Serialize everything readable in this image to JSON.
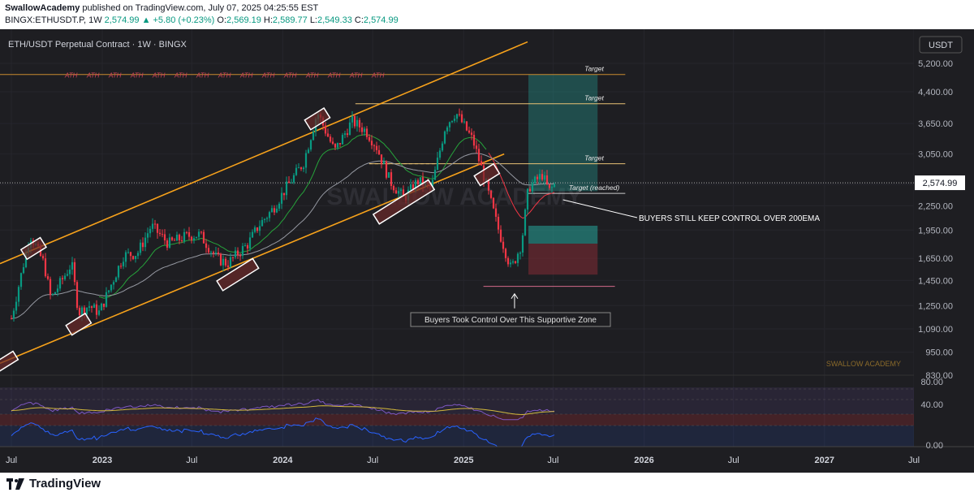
{
  "header": {
    "author": "SwallowAcademy",
    "published": "published on TradingView.com, July 07, 2025 04:25:55 EST",
    "symbol": "BINGX:ETHUSDT.P, 1W",
    "last": "2,574.99",
    "change": "▲ +5.80 (+0.23%)",
    "o_label": "O:",
    "o": "2,569.19",
    "h_label": "H:",
    "h": "2,589.77",
    "l_label": "L:",
    "l": "2,549.33",
    "c_label": "C:",
    "c": "2,574.99"
  },
  "pane": {
    "title": "ETH/USDT Perpetual Contract · 1W · BINGX",
    "currency": "USDT",
    "watermark": "SWALLOW ACADEMY",
    "watermark_small": "SWALLOW ACADEMY"
  },
  "annotations": {
    "ath": "ATH",
    "target": "Target",
    "target_reached": "Target (reached)",
    "buyers_200ema": "BUYERS STILL KEEP CONTROL OVER 200EMA",
    "buyers_zone": "Buyers Took Control Over This Supportive Zone"
  },
  "footer": {
    "brand": "TradingView"
  },
  "colors": {
    "bg": "#1e1e22",
    "up": "#089981",
    "down": "#f23645",
    "channel": "#f7a21b",
    "target_line": "#e8c274",
    "ema_short": "#26a33b",
    "ema_long": "#9598a1",
    "rsi": "#7e57c2",
    "rsi_ma": "#d4b93c",
    "osc": "#2962ff",
    "tp_zone": "#26a69a",
    "sl_zone": "#7a2a33",
    "ath_line": "#c88a2e",
    "ath_text": "#d0435a"
  },
  "chart_data": {
    "type": "candlestick",
    "title": "ETH/USDT Perpetual Contract · 1W · BINGX",
    "y_scale": "log",
    "ylim": [
      830,
      5200
    ],
    "y_ticks": [
      5200,
      4400,
      3650,
      3050,
      2550,
      2250,
      1950,
      1650,
      1450,
      1250,
      1090,
      950,
      830
    ],
    "y_tick_labels": [
      "5,200.00",
      "4,400.00",
      "3,650.00",
      "3,050.00",
      "2,550.00",
      "2,250.00",
      "1,950.00",
      "1,650.00",
      "1,450.00",
      "1,250.00",
      "1,090.00",
      "950.00",
      "830.00"
    ],
    "x_ticks": [
      "2022-07",
      "2023-01",
      "2023-07",
      "2024-01",
      "2024-07",
      "2025-01",
      "2025-07",
      "2026-01",
      "2026-07",
      "2027-01",
      "2027-07"
    ],
    "x_tick_labels": [
      "Jul",
      "2023",
      "Jul",
      "2024",
      "Jul",
      "2025",
      "Jul",
      "2026",
      "Jul",
      "2027",
      "Jul"
    ],
    "price_path": [
      [
        "2022-06-13",
        1000
      ],
      [
        "2022-06-27",
        1100
      ],
      [
        "2022-08-08",
        1900
      ],
      [
        "2022-09-05",
        1600
      ],
      [
        "2022-09-19",
        1300
      ],
      [
        "2022-10-31",
        1600
      ],
      [
        "2022-11-14",
        1200
      ],
      [
        "2022-12-05",
        1250
      ],
      [
        "2022-12-26",
        1200
      ],
      [
        "2023-02-13",
        1680
      ],
      [
        "2023-03-13",
        1700
      ],
      [
        "2023-04-10",
        2000
      ],
      [
        "2023-05-15",
        1800
      ],
      [
        "2023-06-19",
        1880
      ],
      [
        "2023-07-17",
        1900
      ],
      [
        "2023-08-21",
        1650
      ],
      [
        "2023-09-11",
        1600
      ],
      [
        "2023-10-23",
        1800
      ],
      [
        "2023-11-13",
        2000
      ],
      [
        "2023-12-11",
        2200
      ],
      [
        "2024-01-08",
        2500
      ],
      [
        "2024-02-12",
        2900
      ],
      [
        "2024-03-11",
        3900
      ],
      [
        "2024-04-15",
        3100
      ],
      [
        "2024-05-20",
        3700
      ],
      [
        "2024-06-17",
        3500
      ],
      [
        "2024-07-08",
        3200
      ],
      [
        "2024-08-05",
        2600
      ],
      [
        "2024-09-02",
        2350
      ],
      [
        "2024-09-30",
        2600
      ],
      [
        "2024-10-28",
        2500
      ],
      [
        "2024-11-25",
        3600
      ],
      [
        "2024-12-16",
        3900
      ],
      [
        "2025-01-20",
        3300
      ],
      [
        "2025-02-10",
        2700
      ],
      [
        "2025-03-10",
        2000
      ],
      [
        "2025-04-07",
        1550
      ],
      [
        "2025-04-28",
        1800
      ],
      [
        "2025-05-12",
        2500
      ],
      [
        "2025-06-09",
        2700
      ],
      [
        "2025-06-23",
        2450
      ],
      [
        "2025-07-07",
        2575
      ]
    ],
    "current_price": 2574.99,
    "levels": [
      {
        "label": "ATH",
        "price": 4870
      },
      {
        "label": "Target",
        "price": 4870
      },
      {
        "label": "Target",
        "price": 4100
      },
      {
        "label": "Target",
        "price": 2880
      },
      {
        "label": "Target (reached)",
        "price": 2420
      },
      {
        "label": "",
        "price": 1400
      }
    ],
    "position": {
      "entry": 2450,
      "take_profit": 4870,
      "stop": 1500
    }
  }
}
